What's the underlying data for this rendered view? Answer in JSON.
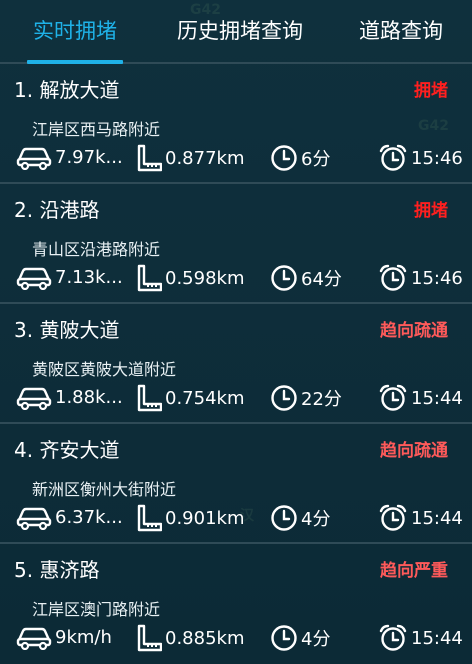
{
  "tabs": [
    {
      "label": "实时拥堵",
      "active": true
    },
    {
      "label": "历史拥堵查询",
      "active": false
    },
    {
      "label": "道路查询",
      "active": false
    }
  ],
  "colors": {
    "background": "#0e2c39",
    "accent": "#1fb2e8",
    "status_congested": "#ff1f1f",
    "status_trending": "#ff5a5a",
    "divider": "#2f4b57"
  },
  "items": [
    {
      "title": "1. 解放大道",
      "status": "拥堵",
      "status_level": "red",
      "area": "江岸区西马路附近",
      "speed": "7.97k...",
      "length": "0.877km",
      "duration": "6分",
      "time": "15:46"
    },
    {
      "title": "2. 沿港路",
      "status": "拥堵",
      "status_level": "red",
      "area": "青山区沿港路附近",
      "speed": "7.13k...",
      "length": "0.598km",
      "duration": "64分",
      "time": "15:46"
    },
    {
      "title": "3. 黄陂大道",
      "status": "趋向疏通",
      "status_level": "pink",
      "area": "黄陂区黄陂大道附近",
      "speed": "1.88k...",
      "length": "0.754km",
      "duration": "22分",
      "time": "15:44"
    },
    {
      "title": "4. 齐安大道",
      "status": "趋向疏通",
      "status_level": "pink",
      "area": "新洲区衡州大街附近",
      "speed": "6.37k...",
      "length": "0.901km",
      "duration": "4分",
      "time": "15:44"
    },
    {
      "title": "5. 惠济路",
      "status": "趋向严重",
      "status_level": "pink",
      "area": "江岸区澳门路附近",
      "speed": "9km/h",
      "length": "0.885km",
      "duration": "4分",
      "time": "15:44"
    }
  ],
  "icons": {
    "speed": "car-icon",
    "length": "ruler-icon",
    "duration": "clock-icon",
    "time": "alarm-clock-icon"
  }
}
